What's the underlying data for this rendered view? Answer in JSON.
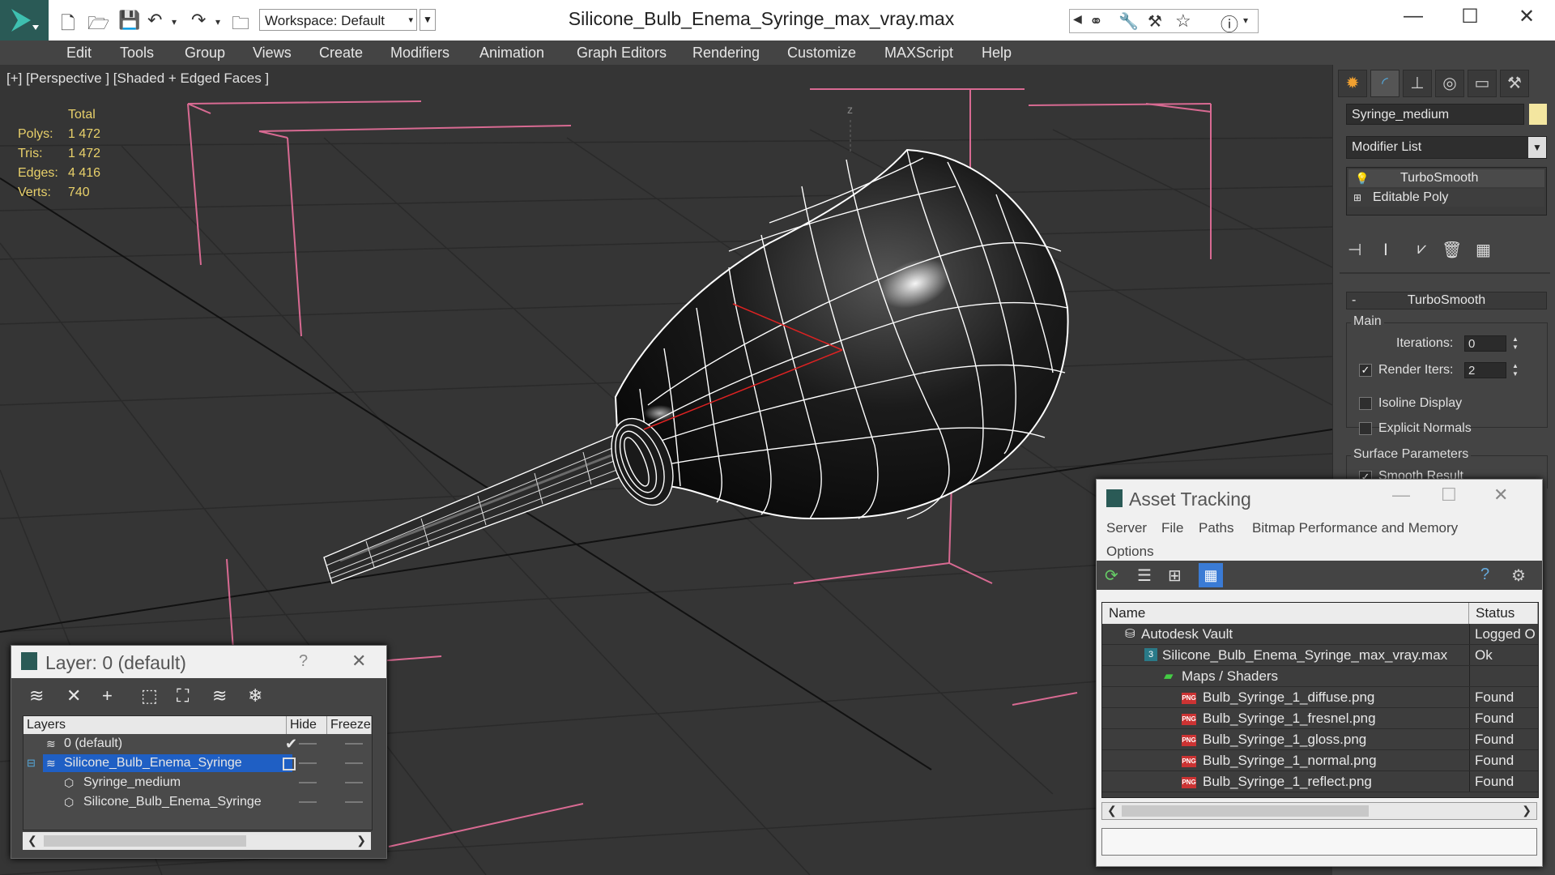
{
  "app": {
    "workspace_label": "Workspace: Default",
    "document_title": "Silicone_Bulb_Enema_Syringe_max_vray.max"
  },
  "menu": [
    "Edit",
    "Tools",
    "Group",
    "Views",
    "Create",
    "Modifiers",
    "Animation",
    "Graph Editors",
    "Rendering",
    "Customize",
    "MAXScript",
    "Help"
  ],
  "viewport": {
    "label": "[+] [Perspective ] [Shaded + Edged Faces ]",
    "axis_label": "z",
    "stats": {
      "header": "Total",
      "rows": [
        {
          "label": "Polys:",
          "value": "1 472"
        },
        {
          "label": "Tris:",
          "value": "1 472"
        },
        {
          "label": "Edges:",
          "value": "4 416"
        },
        {
          "label": "Verts:",
          "value": "740"
        }
      ]
    }
  },
  "command_panel": {
    "object_name": "Syringe_medium",
    "object_color": "#f3e6a0",
    "modifier_list": "Modifier List",
    "stack": [
      "TurboSmooth",
      "Editable Poly"
    ],
    "rollout_title": "TurboSmooth",
    "group_main": "Main",
    "iterations_label": "Iterations:",
    "iterations_value": "0",
    "render_iters_label": "Render Iters:",
    "render_iters_value": "2",
    "render_iters_checked": true,
    "isoline_label": "Isoline Display",
    "explicit_normals_label": "Explicit Normals",
    "group_surface": "Surface Parameters",
    "smooth_result_label": "Smooth Result"
  },
  "layer_dialog": {
    "title": "Layer: 0 (default)",
    "help": "?",
    "columns": [
      "Layers",
      "Hide",
      "Freeze"
    ],
    "rows": [
      {
        "name": "0 (default)",
        "indent": 1,
        "type": "layer"
      },
      {
        "name": "Silicone_Bulb_Enema_Syringe",
        "indent": 1,
        "type": "layer",
        "selected": true
      },
      {
        "name": "Syringe_medium",
        "indent": 2,
        "type": "object"
      },
      {
        "name": "Silicone_Bulb_Enema_Syringe",
        "indent": 2,
        "type": "object"
      }
    ]
  },
  "asset_dialog": {
    "title": "Asset Tracking",
    "menu": [
      "Server",
      "File",
      "Paths",
      "Bitmap Performance and Memory",
      "Options"
    ],
    "columns": [
      "Name",
      "Status"
    ],
    "rows": [
      {
        "name": "Autodesk Vault",
        "status": "Logged O",
        "indent": 0,
        "icon": "vault"
      },
      {
        "name": "Silicone_Bulb_Enema_Syringe_max_vray.max",
        "status": "Ok",
        "indent": 1,
        "icon": "max"
      },
      {
        "name": "Maps / Shaders",
        "status": "",
        "indent": 2,
        "icon": "folder"
      },
      {
        "name": "Bulb_Syringe_1_diffuse.png",
        "status": "Found",
        "indent": 3,
        "icon": "png"
      },
      {
        "name": "Bulb_Syringe_1_fresnel.png",
        "status": "Found",
        "indent": 3,
        "icon": "png"
      },
      {
        "name": "Bulb_Syringe_1_gloss.png",
        "status": "Found",
        "indent": 3,
        "icon": "png"
      },
      {
        "name": "Bulb_Syringe_1_normal.png",
        "status": "Found",
        "indent": 3,
        "icon": "png"
      },
      {
        "name": "Bulb_Syringe_1_reflect.png",
        "status": "Found",
        "indent": 3,
        "icon": "png"
      }
    ],
    "png_badge": "PNG"
  }
}
